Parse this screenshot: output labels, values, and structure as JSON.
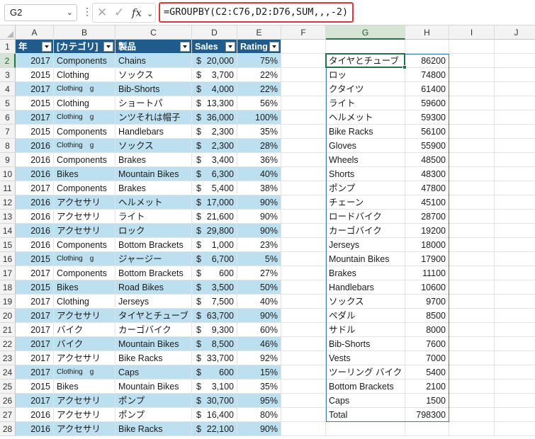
{
  "formula_bar": {
    "name_box": "G2",
    "formula": "=GROUPBY(C2:C76,D2:D76,SUM,,,-2)"
  },
  "columns": [
    "A",
    "B",
    "C",
    "D",
    "E",
    "F",
    "G",
    "H",
    "I",
    "J"
  ],
  "table": {
    "headers": [
      "年",
      "[カテゴリ]",
      "製品",
      "Sales",
      "Rating"
    ],
    "rows": [
      {
        "year": "2017",
        "category": "Components",
        "product": "Chains",
        "sales": "20,000",
        "rating": "75%"
      },
      {
        "year": "2015",
        "category": "Clothing",
        "product": "ソックス",
        "sales": "3,700",
        "rating": "22%"
      },
      {
        "year": "2017",
        "category": "Clothing　g",
        "product": "Bib-Shorts",
        "sales": "4,000",
        "rating": "22%"
      },
      {
        "year": "2015",
        "category": "Clothing",
        "product": "ショートパ",
        "sales": "13,300",
        "rating": "56%"
      },
      {
        "year": "2017",
        "category": "Clothing　g",
        "product": "ンツそれは帽子",
        "sales": "36,000",
        "rating": "100%"
      },
      {
        "year": "2015",
        "category": "Components",
        "product": "Handlebars",
        "sales": "2,300",
        "rating": "35%"
      },
      {
        "year": "2016",
        "category": "Clothing　g",
        "product": "ソックス",
        "sales": "2,300",
        "rating": "28%"
      },
      {
        "year": "2016",
        "category": "Components",
        "product": "Brakes",
        "sales": "3,400",
        "rating": "36%"
      },
      {
        "year": "2016",
        "category": "Bikes",
        "product": "Mountain Bikes",
        "sales": "6,300",
        "rating": "40%"
      },
      {
        "year": "2017",
        "category": "Components",
        "product": "Brakes",
        "sales": "5,400",
        "rating": "38%"
      },
      {
        "year": "2016",
        "category": "アクセサリ",
        "product": "ヘルメット",
        "sales": "17,000",
        "rating": "90%"
      },
      {
        "year": "2016",
        "category": "アクセサリ",
        "product": "ライト",
        "sales": "21,600",
        "rating": "90%"
      },
      {
        "year": "2016",
        "category": "アクセサリ",
        "product": "ロック",
        "sales": "29,800",
        "rating": "90%"
      },
      {
        "year": "2016",
        "category": "Components",
        "product": "Bottom Brackets",
        "sales": "1,000",
        "rating": "23%"
      },
      {
        "year": "2015",
        "category": "Clothing　g",
        "product": "ジャージー",
        "sales": "6,700",
        "rating": "5%"
      },
      {
        "year": "2017",
        "category": "Components",
        "product": "Bottom Brackets",
        "sales": "600",
        "rating": "27%"
      },
      {
        "year": "2015",
        "category": "Bikes",
        "product": "Road Bikes",
        "sales": "3,500",
        "rating": "50%"
      },
      {
        "year": "2017",
        "category": "Clothing",
        "product": "Jerseys",
        "sales": "7,500",
        "rating": "40%"
      },
      {
        "year": "2017",
        "category": "アクセサリ",
        "product": "タイヤとチューブ",
        "sales": "63,700",
        "rating": "90%"
      },
      {
        "year": "2017",
        "category": "バイク",
        "product": "カーゴバイク",
        "sales": "9,300",
        "rating": "60%"
      },
      {
        "year": "2017",
        "category": "バイク",
        "product": "Mountain Bikes",
        "sales": "8,500",
        "rating": "46%"
      },
      {
        "year": "2017",
        "category": "アクセサリ",
        "product": "Bike Racks",
        "sales": "33,700",
        "rating": "92%"
      },
      {
        "year": "2017",
        "category": "Clothing　g",
        "product": "Caps",
        "sales": "600",
        "rating": "15%"
      },
      {
        "year": "2015",
        "category": "Bikes",
        "product": "Mountain Bikes",
        "sales": "3,100",
        "rating": "35%"
      },
      {
        "year": "2017",
        "category": "アクセサリ",
        "product": "ポンプ",
        "sales": "30,700",
        "rating": "95%"
      },
      {
        "year": "2016",
        "category": "アクセサリ",
        "product": "ポンプ",
        "sales": "16,400",
        "rating": "80%"
      },
      {
        "year": "2016",
        "category": "アクセサリ",
        "product": "Bike Racks",
        "sales": "22,100",
        "rating": "90%"
      }
    ]
  },
  "groupby": [
    {
      "label": "タイヤとチューブ",
      "value": "86200"
    },
    {
      "label": "ロッ",
      "value": "74800"
    },
    {
      "label": "クタイツ",
      "value": "61400"
    },
    {
      "label": "ライト",
      "value": "59600"
    },
    {
      "label": "ヘルメット",
      "value": "59300"
    },
    {
      "label": "Bike Racks",
      "value": "56100"
    },
    {
      "label": "Gloves",
      "value": "55900"
    },
    {
      "label": "Wheels",
      "value": "48500"
    },
    {
      "label": "Shorts",
      "value": "48300"
    },
    {
      "label": "ポンプ",
      "value": "47800"
    },
    {
      "label": "チェーン",
      "value": "45100"
    },
    {
      "label": "ロードバイク",
      "value": "28700"
    },
    {
      "label": "カーゴバイク",
      "value": "19200"
    },
    {
      "label": "Jerseys",
      "value": "18000"
    },
    {
      "label": "Mountain Bikes",
      "value": "17900"
    },
    {
      "label": "Brakes",
      "value": "11100"
    },
    {
      "label": "Handlebars",
      "value": "10600"
    },
    {
      "label": "ソックス",
      "value": "9700"
    },
    {
      "label": "ペダル",
      "value": "8500"
    },
    {
      "label": "サドル",
      "value": "8000"
    },
    {
      "label": "Bib-Shorts",
      "value": "7600"
    },
    {
      "label": "Vests",
      "value": "7000"
    },
    {
      "label": "ツーリング バイク",
      "value": "5400"
    },
    {
      "label": "Bottom Brackets",
      "value": "2100"
    },
    {
      "label": "Caps",
      "value": "1500"
    },
    {
      "label": "Total",
      "value": "798300"
    }
  ],
  "currency_symbol": "$",
  "colors": {
    "table_header": "#1f5c8c",
    "band": "#bde0f0",
    "spill_border": "#3b73c9",
    "formula_highlight": "#e0343a",
    "selection": "#217346"
  }
}
